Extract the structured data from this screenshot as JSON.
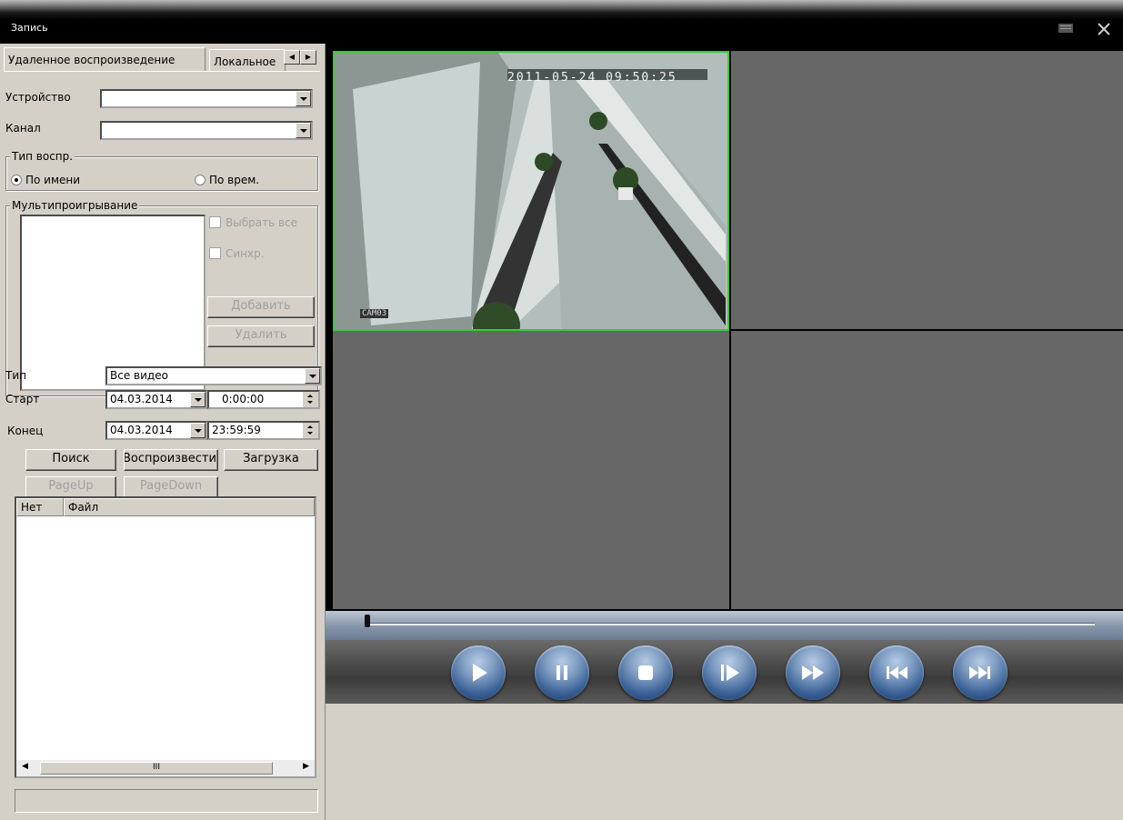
{
  "window": {
    "title": "Запись"
  },
  "tabs": [
    {
      "label": "Удаленное воспроизведение"
    },
    {
      "label": "Локальное"
    }
  ],
  "form": {
    "device_label": "Устройство",
    "device_value": "",
    "channel_label": "Канал",
    "channel_value": "",
    "playback_type_group": "Тип воспр.",
    "radio_by_name": "По имени",
    "radio_by_time": "По врем.",
    "selected_radio": "by_name",
    "multiplay_group": "Мультипроигрывание",
    "select_all": "Выбрать все",
    "sync": "Синхр.",
    "add_button": "Добавить",
    "delete_button": "Удалить",
    "type_label": "Тип",
    "type_value": "Все видео",
    "start_label": "Старт",
    "start_date": "04.03.2014",
    "start_time": "0:00:00",
    "end_label": "Конец",
    "end_date": "04.03.2014",
    "end_time": "23:59:59",
    "search_button": "Поиск",
    "play_button": "Воспроизвести",
    "download_button": "Загрузка",
    "pageup_button": "PageUp",
    "pagedown_button": "PageDown"
  },
  "file_list": {
    "columns": [
      "Нет",
      "Файл"
    ],
    "rows": [],
    "scroll_thumb_label": "III"
  },
  "video": {
    "pane1_timestamp": "2011-05-24 09:50:25",
    "pane1_camera": "CAM03"
  },
  "playback": {
    "progress": 0.0,
    "buttons": [
      "play-icon",
      "pause-icon",
      "stop-icon",
      "step-forward-icon",
      "fast-forward-icon",
      "skip-back-icon",
      "skip-forward-icon"
    ]
  },
  "colors": {
    "active_pane_border": "#3bc93b",
    "empty_pane": "#676767",
    "control_button": "#365e92"
  }
}
